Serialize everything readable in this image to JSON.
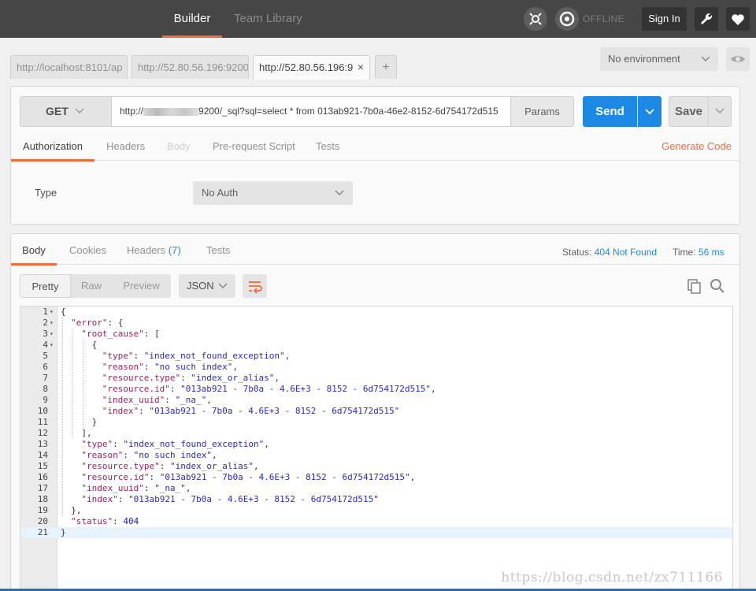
{
  "topbar": {
    "tabs": [
      {
        "label": "Builder"
      },
      {
        "label": "Team Library"
      }
    ],
    "status": "OFFLINE",
    "sign_in": "Sign In",
    "icons": [
      "interceptor-icon",
      "sync-icon",
      "wrench-icon",
      "heart-icon"
    ]
  },
  "request_tabs": [
    {
      "label": "http://localhost:8101/ap"
    },
    {
      "label": "http://52.80.56.196:9200"
    },
    {
      "label": "http://52.80.56.196:9",
      "close": "×"
    }
  ],
  "add_tab": "+",
  "environment": {
    "value": "No environment"
  },
  "request": {
    "method": "GET",
    "url_prefix": "http://",
    "url_rest": "9200/_sql?sql=select * from 013ab921-7b0a-46e2-8152-6d754172d515",
    "params": "Params",
    "send": "Send",
    "save": "Save",
    "tabs": [
      "Authorization",
      "Headers",
      "Body",
      "Pre-request Script",
      "Tests"
    ],
    "generate_code": "Generate Code",
    "auth": {
      "type_label": "Type",
      "type_value": "No Auth"
    }
  },
  "response": {
    "tabs": [
      "Body",
      "Cookies",
      "Headers",
      "Tests"
    ],
    "headers_count": "(7)",
    "status_label": "Status:",
    "status_value": "404 Not Found",
    "time_label": "Time:",
    "time_value": "56 ms",
    "view_modes": [
      "Pretty",
      "Raw",
      "Preview"
    ],
    "format": "JSON",
    "lines": [
      {
        "n": "1",
        "fold": true,
        "indent": 0,
        "tokens": [
          [
            "p",
            "{"
          ]
        ]
      },
      {
        "n": "2",
        "fold": true,
        "indent": 1,
        "tokens": [
          [
            "k",
            "\"error\""
          ],
          [
            "p",
            ": {"
          ]
        ]
      },
      {
        "n": "3",
        "fold": true,
        "indent": 2,
        "tokens": [
          [
            "k",
            "\"root_cause\""
          ],
          [
            "p",
            ": ["
          ]
        ]
      },
      {
        "n": "4",
        "fold": true,
        "indent": 3,
        "tokens": [
          [
            "p",
            "{"
          ]
        ]
      },
      {
        "n": "5",
        "indent": 4,
        "tokens": [
          [
            "k",
            "\"type\""
          ],
          [
            "p",
            ": "
          ],
          [
            "s",
            "\"index_not_found_exception\""
          ],
          [
            "p",
            ","
          ]
        ]
      },
      {
        "n": "6",
        "indent": 4,
        "tokens": [
          [
            "k",
            "\"reason\""
          ],
          [
            "p",
            ": "
          ],
          [
            "s",
            "\"no such index\""
          ],
          [
            "p",
            ","
          ]
        ]
      },
      {
        "n": "7",
        "indent": 4,
        "tokens": [
          [
            "k",
            "\"resource.type\""
          ],
          [
            "p",
            ": "
          ],
          [
            "s",
            "\"index_or_alias\""
          ],
          [
            "p",
            ","
          ]
        ]
      },
      {
        "n": "8",
        "indent": 4,
        "tokens": [
          [
            "k",
            "\"resource.id\""
          ],
          [
            "p",
            ": "
          ],
          [
            "s",
            "\"013ab921 - 7b0a - 4.6E+3 - 8152 - 6d754172d515\""
          ],
          [
            "p",
            ","
          ]
        ]
      },
      {
        "n": "9",
        "indent": 4,
        "tokens": [
          [
            "k",
            "\"index_uuid\""
          ],
          [
            "p",
            ": "
          ],
          [
            "s",
            "\"_na_\""
          ],
          [
            "p",
            ","
          ]
        ]
      },
      {
        "n": "10",
        "indent": 4,
        "tokens": [
          [
            "k",
            "\"index\""
          ],
          [
            "p",
            ": "
          ],
          [
            "s",
            "\"013ab921 - 7b0a - 4.6E+3 - 8152 - 6d754172d515\""
          ]
        ]
      },
      {
        "n": "11",
        "indent": 3,
        "tokens": [
          [
            "p",
            "}"
          ]
        ]
      },
      {
        "n": "12",
        "indent": 2,
        "tokens": [
          [
            "p",
            "],"
          ]
        ]
      },
      {
        "n": "13",
        "indent": 2,
        "tokens": [
          [
            "k",
            "\"type\""
          ],
          [
            "p",
            ": "
          ],
          [
            "s",
            "\"index_not_found_exception\""
          ],
          [
            "p",
            ","
          ]
        ]
      },
      {
        "n": "14",
        "indent": 2,
        "tokens": [
          [
            "k",
            "\"reason\""
          ],
          [
            "p",
            ": "
          ],
          [
            "s",
            "\"no such index\""
          ],
          [
            "p",
            ","
          ]
        ]
      },
      {
        "n": "15",
        "indent": 2,
        "tokens": [
          [
            "k",
            "\"resource.type\""
          ],
          [
            "p",
            ": "
          ],
          [
            "s",
            "\"index_or_alias\""
          ],
          [
            "p",
            ","
          ]
        ]
      },
      {
        "n": "16",
        "indent": 2,
        "tokens": [
          [
            "k",
            "\"resource.id\""
          ],
          [
            "p",
            ": "
          ],
          [
            "s",
            "\"013ab921 - 7b0a - 4.6E+3 - 8152 - 6d754172d515\""
          ],
          [
            "p",
            ","
          ]
        ]
      },
      {
        "n": "17",
        "indent": 2,
        "tokens": [
          [
            "k",
            "\"index_uuid\""
          ],
          [
            "p",
            ": "
          ],
          [
            "s",
            "\"_na_\""
          ],
          [
            "p",
            ","
          ]
        ]
      },
      {
        "n": "18",
        "indent": 2,
        "tokens": [
          [
            "k",
            "\"index\""
          ],
          [
            "p",
            ": "
          ],
          [
            "s",
            "\"013ab921 - 7b0a - 4.6E+3 - 8152 - 6d754172d515\""
          ]
        ]
      },
      {
        "n": "19",
        "indent": 1,
        "tokens": [
          [
            "p",
            "},"
          ]
        ]
      },
      {
        "n": "20",
        "indent": 1,
        "tokens": [
          [
            "k",
            "\"status\""
          ],
          [
            "p",
            ": "
          ],
          [
            "n",
            "404"
          ]
        ]
      },
      {
        "n": "21",
        "indent": 0,
        "highlight": true,
        "tokens": [
          [
            "p",
            "}"
          ]
        ]
      }
    ]
  },
  "watermark": "https://blog.csdn.net/zx711166",
  "colors": {
    "accent": "#f26b3a",
    "primary": "#1e88e5",
    "topbar": "#464646"
  }
}
